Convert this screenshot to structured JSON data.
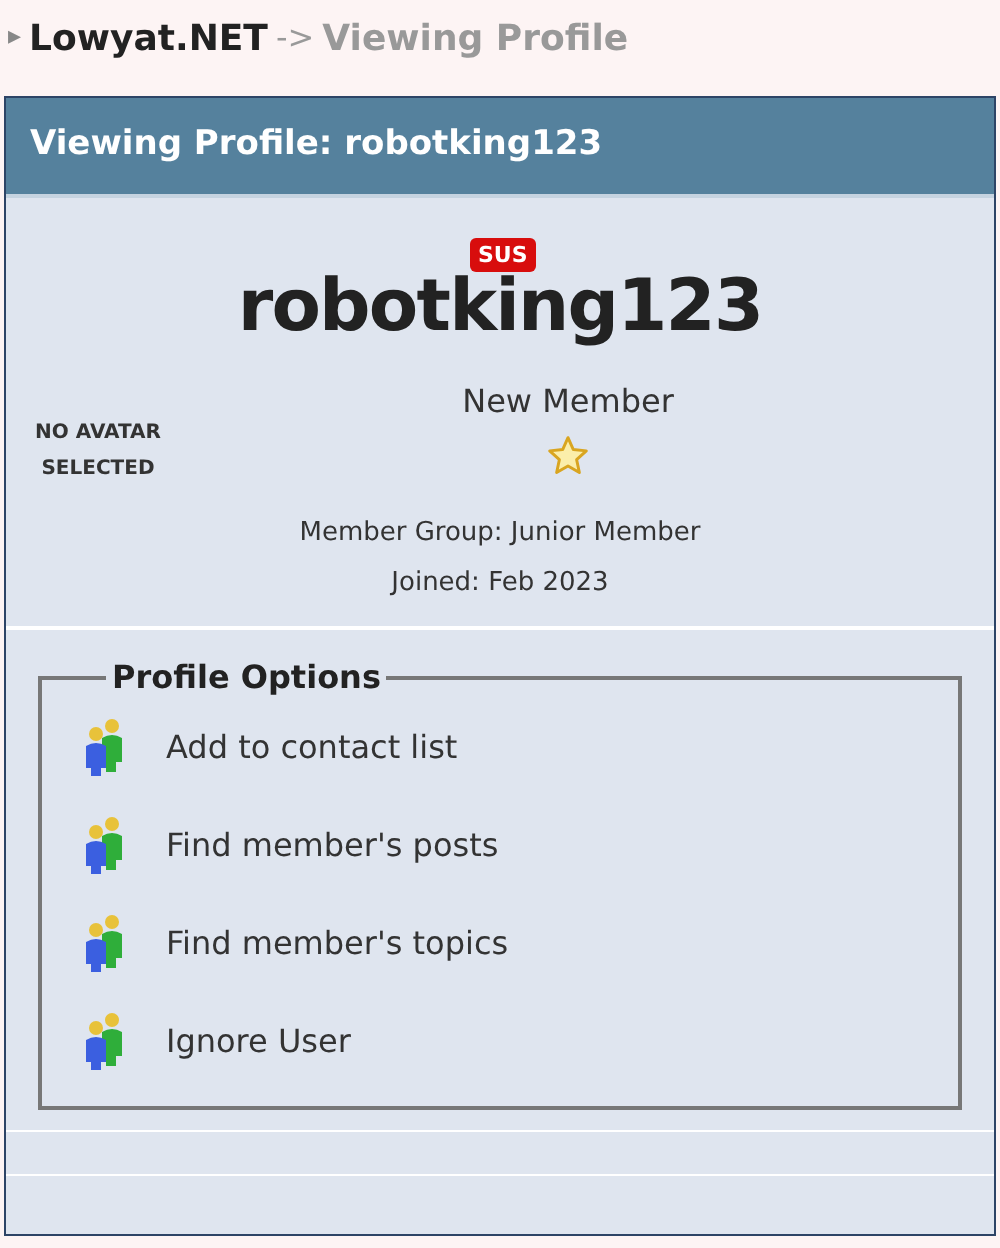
{
  "breadcrumb": {
    "arrow": "▸",
    "site": "Lowyat.NET",
    "separator": "->",
    "current": "Viewing Profile"
  },
  "panel": {
    "title": "Viewing Profile: robotking123"
  },
  "profile": {
    "avatar_text": "NO AVATAR SELECTED",
    "badge": "SUS",
    "username": "robotking123",
    "rank": "New Member",
    "member_group": "Member Group: Junior Member",
    "joined": "Joined: Feb 2023"
  },
  "options": {
    "title": "Profile Options",
    "items": [
      {
        "label": "Add to contact list"
      },
      {
        "label": "Find member's posts"
      },
      {
        "label": "Find member's topics"
      },
      {
        "label": "Ignore User"
      }
    ]
  }
}
